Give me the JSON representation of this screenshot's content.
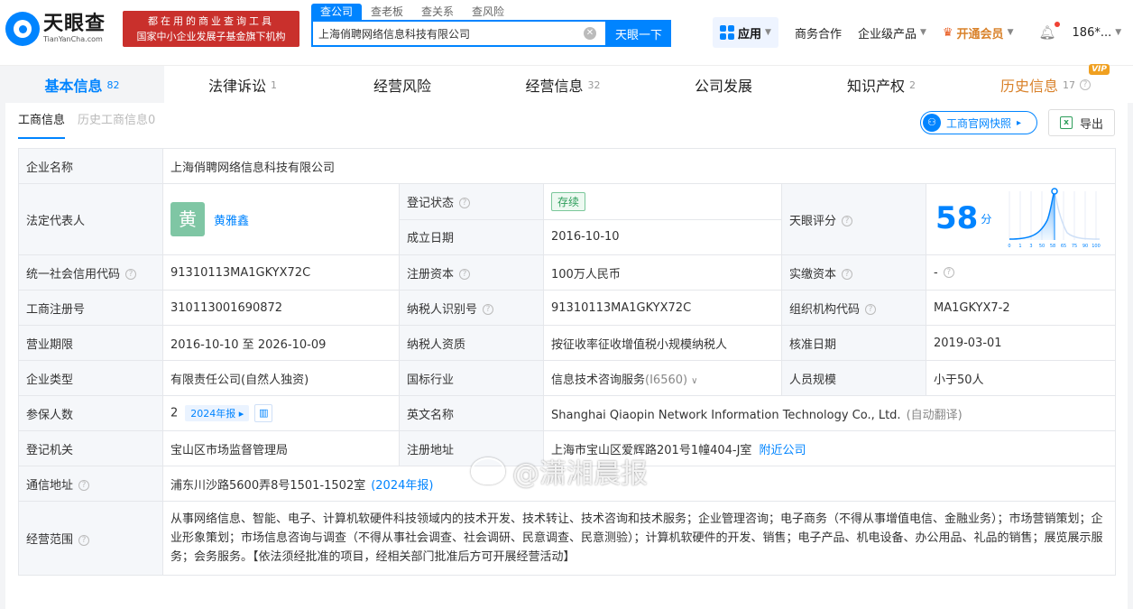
{
  "header": {
    "logo_cn": "天眼查",
    "logo_en": "TianYanCha.com",
    "slogan_line1": "都在用的商业查询工具",
    "slogan_line2": "国家中小企业发展子基金旗下机构",
    "search_tabs": [
      "查公司",
      "查老板",
      "查关系",
      "查风险"
    ],
    "search_value": "上海俏聘网络信息科技有限公司",
    "search_button": "天眼一下",
    "app_label": "应用",
    "nav": [
      "商务合作",
      "企业级产品"
    ],
    "vip_label": "开通会员",
    "user_label": "186*..."
  },
  "main_tabs": [
    {
      "label": "基本信息",
      "count": "82"
    },
    {
      "label": "法律诉讼",
      "count": "1"
    },
    {
      "label": "经营风险",
      "count": ""
    },
    {
      "label": "经营信息",
      "count": "32"
    },
    {
      "label": "公司发展",
      "count": ""
    },
    {
      "label": "知识产权",
      "count": "2"
    },
    {
      "label": "历史信息",
      "count": "17",
      "badge": "VIP"
    }
  ],
  "sub_tabs": [
    "工商信息",
    "历史工商信息0"
  ],
  "actions": {
    "snapshot": "工商官网快照",
    "export": "导出"
  },
  "info": {
    "company_name_k": "企业名称",
    "company_name_v": "上海俏聘网络信息科技有限公司",
    "legal_rep_k": "法定代表人",
    "legal_rep_avatar": "黄",
    "legal_rep_v": "黄雅鑫",
    "reg_status_k": "登记状态",
    "reg_status_v": "存续",
    "found_date_k": "成立日期",
    "found_date_v": "2016-10-10",
    "score_k": "天眼评分",
    "score_v": "58",
    "score_unit": "分",
    "credit_code_k": "统一社会信用代码",
    "credit_code_v": "91310113MA1GKYX72C",
    "reg_capital_k": "注册资本",
    "reg_capital_v": "100万人民币",
    "paid_capital_k": "实缴资本",
    "paid_capital_v": "-",
    "reg_no_k": "工商注册号",
    "reg_no_v": "310113001690872",
    "taxpayer_id_k": "纳税人识别号",
    "taxpayer_id_v": "91310113MA1GKYX72C",
    "org_code_k": "组织机构代码",
    "org_code_v": "MA1GKYX7-2",
    "term_k": "营业期限",
    "term_v": "2016-10-10 至 2026-10-09",
    "taxpayer_qual_k": "纳税人资质",
    "taxpayer_qual_v": "按征收率征收增值税小规模纳税人",
    "approve_date_k": "核准日期",
    "approve_date_v": "2019-03-01",
    "type_k": "企业类型",
    "type_v": "有限责任公司(自然人独资)",
    "industry_k": "国标行业",
    "industry_v": "信息技术咨询服务",
    "industry_code": "(I6560)",
    "staff_k": "人员规模",
    "staff_v": "小于50人",
    "insured_k": "参保人数",
    "insured_v": "2",
    "insured_report": "2024年报",
    "en_name_k": "英文名称",
    "en_name_v": "Shanghai Qiaopin Network Information Technology Co., Ltd.",
    "en_name_note": "(自动翻译)",
    "authority_k": "登记机关",
    "authority_v": "宝山区市场监督管理局",
    "address_k": "注册地址",
    "address_v": "上海市宝山区爱辉路201号1幢404-J室",
    "address_link": "附近公司",
    "mail_k": "通信地址",
    "mail_v": "浦东川沙路5600弄8号1501-1502室",
    "mail_report": "(2024年报)",
    "scope_k": "经营范围",
    "scope_v": "从事网络信息、智能、电子、计算机软硬件科技领域内的技术开发、技术转让、技术咨询和技术服务；企业管理咨询；电子商务（不得从事增值电信、金融业务）；市场营销策划；企业形象策划；市场信息咨询与调查（不得从事社会调查、社会调研、民意调查、民意测验）；计算机软硬件的开发、销售；电子产品、机电设备、办公用品、礼品的销售；展览展示服务；会务服务。【依法须经批准的项目，经相关部门批准后方可开展经营活动】"
  },
  "score_chart_ticks": [
    "0",
    "1",
    "3",
    "50",
    "58",
    "65",
    "75",
    "90",
    "100"
  ],
  "watermark": "@潇湘晨报",
  "colors": {
    "brand": "#0084ff",
    "vip": "#d9822b",
    "slogan_bg": "#c9302c",
    "status": "#2e9e5b"
  }
}
